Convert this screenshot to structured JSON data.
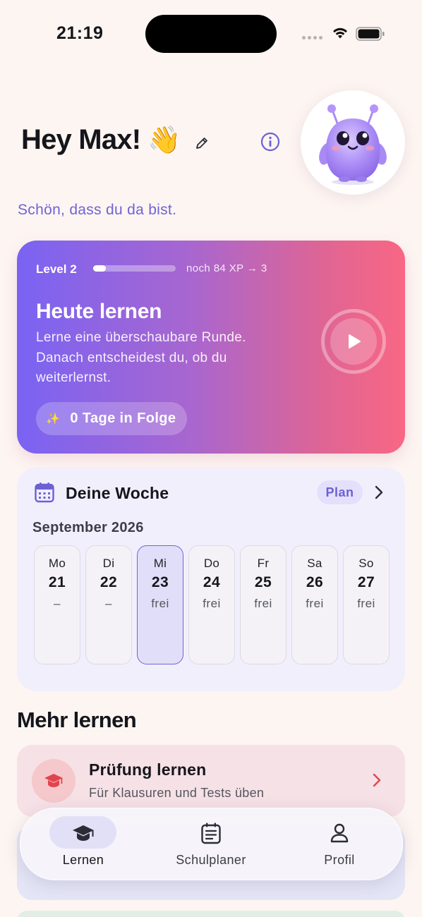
{
  "status_bar": {
    "time": "21:19"
  },
  "header": {
    "greeting": "Hey Max!",
    "wave_emoji": "👋",
    "subtitle": "Schön, dass du da bist."
  },
  "hero": {
    "level": "Level 2",
    "xp_progress": 0.15,
    "xp_text": "noch 84 XP → 3",
    "title": "Heute lernen",
    "description": "Lerne eine überschaubare Runde. Danach entscheidest du, ob du weiterlernst.",
    "streak_icon": "✨",
    "streak": "0 Tage in Folge",
    "gradient_start": "#7a63f3",
    "gradient_end": "#f96784"
  },
  "week": {
    "title": "Deine Woche",
    "plan_label": "Plan",
    "month": "September 2026",
    "days": [
      {
        "name": "Mo",
        "num": "21",
        "status": "–",
        "selected": false
      },
      {
        "name": "Di",
        "num": "22",
        "status": "–",
        "selected": false
      },
      {
        "name": "Mi",
        "num": "23",
        "status": "frei",
        "selected": true
      },
      {
        "name": "Do",
        "num": "24",
        "status": "frei",
        "selected": false
      },
      {
        "name": "Fr",
        "num": "25",
        "status": "frei",
        "selected": false
      },
      {
        "name": "Sa",
        "num": "26",
        "status": "frei",
        "selected": false
      },
      {
        "name": "So",
        "num": "27",
        "status": "frei",
        "selected": false
      }
    ]
  },
  "more": {
    "title": "Mehr lernen",
    "exam": {
      "title": "Prüfung lernen",
      "subtitle": "Für Klausuren und Tests üben",
      "accent": "#e0454f"
    }
  },
  "tab_bar": {
    "tabs": [
      {
        "label": "Lernen",
        "icon": "graduation-cap-icon",
        "active": true
      },
      {
        "label": "Schulplaner",
        "icon": "planner-icon",
        "active": false
      },
      {
        "label": "Profil",
        "icon": "person-icon",
        "active": false
      }
    ]
  },
  "colors": {
    "accent": "#6c60d6",
    "background": "#fdf5f1"
  }
}
